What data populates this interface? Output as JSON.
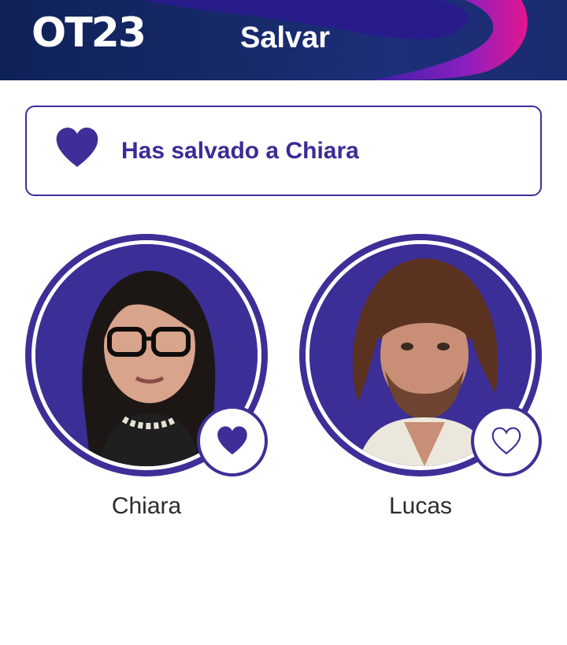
{
  "header": {
    "logo_text": "OT23",
    "title": "Salvar"
  },
  "banner": {
    "text": "Has salvado a Chiara",
    "icon": "heart-filled-icon"
  },
  "contestants": [
    {
      "name": "Chiara",
      "vote_icon": "heart-filled-icon",
      "saved": true
    },
    {
      "name": "Lucas",
      "vote_icon": "heart-outline-icon",
      "saved": false
    }
  ],
  "colors": {
    "brand_purple": "#3d2f97",
    "header_navy": "#172a6b",
    "accent_magenta": "#e0148c",
    "text_dark": "#2b2b2b"
  }
}
